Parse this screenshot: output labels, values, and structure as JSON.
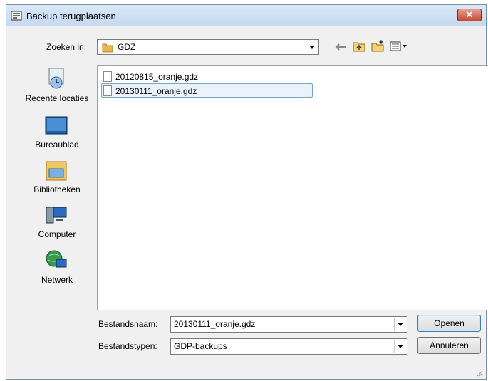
{
  "title": "Backup terugplaatsen",
  "lookin": {
    "label": "Zoeken in:",
    "value": "GDZ"
  },
  "toolbar": {
    "back": "back-icon",
    "up": "up-folder-icon",
    "newfolder": "new-folder-icon",
    "view": "view-menu-icon"
  },
  "places": [
    {
      "label": "Recente locaties",
      "icon": "recent-locations-icon"
    },
    {
      "label": "Bureaublad",
      "icon": "desktop-icon"
    },
    {
      "label": "Bibliotheken",
      "icon": "libraries-icon"
    },
    {
      "label": "Computer",
      "icon": "computer-icon"
    },
    {
      "label": "Netwerk",
      "icon": "network-icon"
    }
  ],
  "files": [
    {
      "name": "20120815_oranje.gdz"
    },
    {
      "name": "20130111_oranje.gdz"
    }
  ],
  "filename": {
    "label": "Bestandsnaam:",
    "value": "20130111_oranje.gdz"
  },
  "filetype": {
    "label": "Bestandstypen:",
    "value": "GDP-backups"
  },
  "buttons": {
    "open": "Openen",
    "cancel": "Annuleren"
  },
  "colors": {
    "selection_bg": "#eaf3fd",
    "selection_border": "#7da2ce",
    "close_red": "#c44a35",
    "folder_yellow": "#e8b84a"
  }
}
